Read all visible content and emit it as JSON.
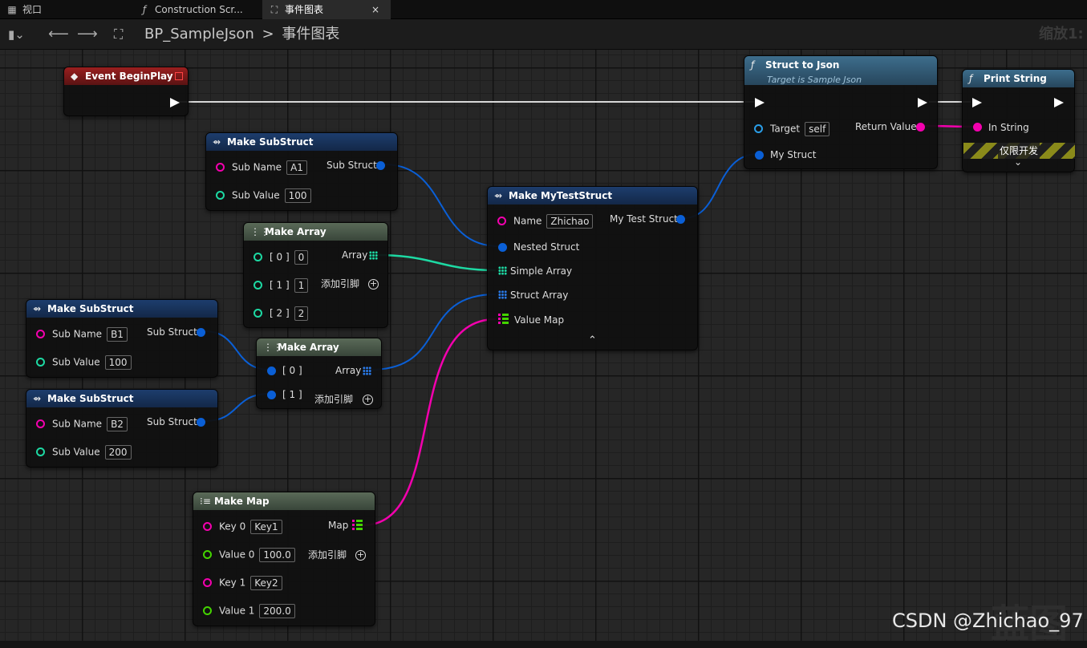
{
  "tabs": [
    {
      "label": "视口",
      "icon": "viewport-icon"
    },
    {
      "label": "Construction Scr...",
      "icon": "function-icon"
    },
    {
      "label": "事件图表",
      "icon": "graph-icon",
      "close": "×"
    }
  ],
  "breadcrumb": {
    "blueprint": "BP_SampleJson",
    "separator": ">",
    "graph": "事件图表"
  },
  "zoom_label": "缩放1:",
  "colors": {
    "exec": "#ffffff",
    "struct": "#0a5fd6",
    "string": "#f300ae",
    "int": "#1dd9a3",
    "float": "#44d400",
    "event_header": "#9a1f1f",
    "make_header": "#1d3d6d",
    "func_header": "#3d6d8c"
  },
  "nodes": {
    "event_begin_play": {
      "title": "Event BeginPlay"
    },
    "make_substruct_a": {
      "title": "Make SubStruct",
      "pins": {
        "sub_name": "Sub Name",
        "sub_name_value": "A1",
        "sub_value": "Sub Value",
        "sub_value_value": "100",
        "out": "Sub Struct"
      }
    },
    "make_array_int": {
      "title": "Make Array",
      "pins": {
        "p0": "[ 0 ]",
        "v0": "0",
        "p1": "[ 1 ]",
        "v1": "1",
        "p2": "[ 2 ]",
        "v2": "2",
        "out": "Array",
        "add": "添加引脚"
      }
    },
    "make_substruct_b1": {
      "title": "Make SubStruct",
      "pins": {
        "sub_name": "Sub Name",
        "sub_name_value": "B1",
        "sub_value": "Sub Value",
        "sub_value_value": "100",
        "out": "Sub Struct"
      }
    },
    "make_substruct_b2": {
      "title": "Make SubStruct",
      "pins": {
        "sub_name": "Sub Name",
        "sub_name_value": "B2",
        "sub_value": "Sub Value",
        "sub_value_value": "200",
        "out": "Sub Struct"
      }
    },
    "make_array_struct": {
      "title": "Make Array",
      "pins": {
        "p0": "[ 0 ]",
        "p1": "[ 1 ]",
        "out": "Array",
        "add": "添加引脚"
      }
    },
    "make_map": {
      "title": "Make Map",
      "pins": {
        "key0": "Key 0",
        "key0_value": "Key1",
        "value0": "Value 0",
        "value0_value": "100.0",
        "key1": "Key 1",
        "key1_value": "Key2",
        "value1": "Value 1",
        "value1_value": "200.0",
        "out": "Map",
        "add": "添加引脚"
      }
    },
    "make_my_test_struct": {
      "title": "Make MyTestStruct",
      "pins": {
        "name": "Name",
        "name_value": "Zhichao",
        "nested": "Nested Struct",
        "simple": "Simple Array",
        "struct_array": "Struct Array",
        "value_map": "Value Map",
        "out": "My Test Struct"
      }
    },
    "struct_to_json": {
      "title": "Struct to Json",
      "subtitle": "Target is Sample Json",
      "pins": {
        "target": "Target",
        "target_value": "self",
        "my_struct": "My Struct",
        "return": "Return Value"
      }
    },
    "print_string": {
      "title": "Print String",
      "pins": {
        "in_string": "In String",
        "dev_only": "仅限开发"
      }
    }
  },
  "watermark": "CSDN @Zhichao_97",
  "watermark_logo": "蓝图"
}
